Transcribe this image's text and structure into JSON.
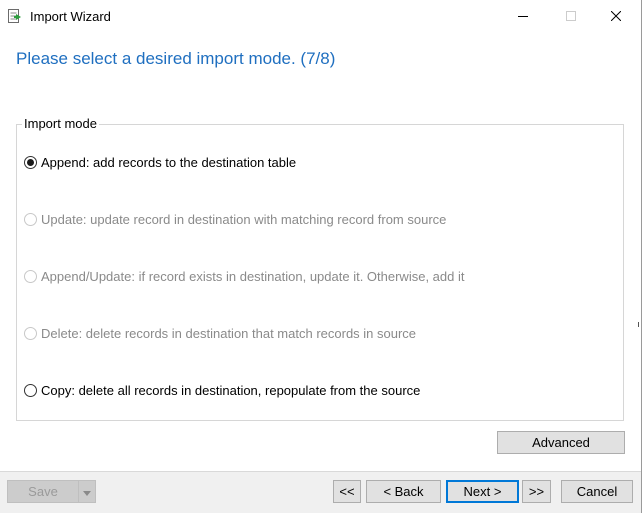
{
  "window": {
    "title": "Import Wizard"
  },
  "heading": "Please select a desired import mode. (7/8)",
  "import_mode": {
    "legend": "Import mode",
    "options": [
      {
        "label": "Append: add records to the destination table",
        "selected": true,
        "enabled": true
      },
      {
        "label": "Update: update record in destination with matching record from source",
        "selected": false,
        "enabled": false
      },
      {
        "label": "Append/Update: if record exists in destination, update it. Otherwise, add it",
        "selected": false,
        "enabled": false
      },
      {
        "label": "Delete: delete records in destination that match records in source",
        "selected": false,
        "enabled": false
      },
      {
        "label": "Copy: delete all records in destination, repopulate from the source",
        "selected": false,
        "enabled": true
      }
    ]
  },
  "buttons": {
    "advanced": "Advanced",
    "save": "Save",
    "first": "<<",
    "back": "< Back",
    "next": "Next >",
    "last": ">>",
    "cancel": "Cancel"
  },
  "colors": {
    "heading": "#1f6fc0",
    "primary_border": "#0078d7"
  },
  "icons": {
    "app": "import-wizard-icon",
    "minimize": "minimize-icon",
    "maximize": "maximize-icon",
    "close": "close-icon",
    "dropdown": "chevron-down-icon"
  }
}
